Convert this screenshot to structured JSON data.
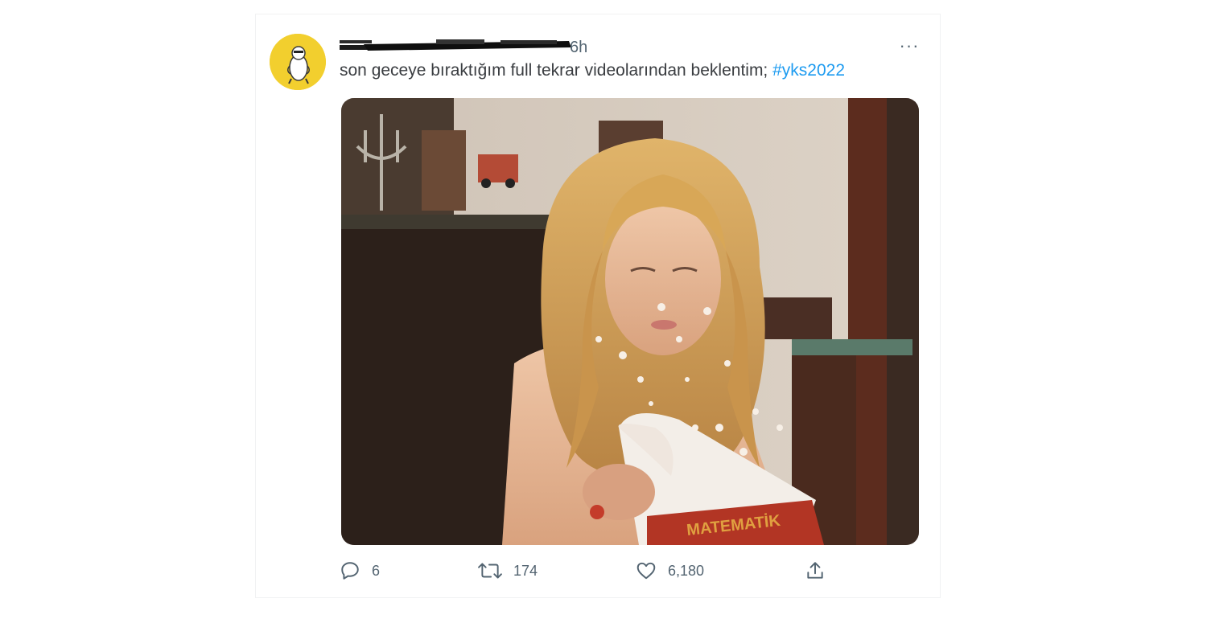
{
  "tweet": {
    "handle_time": "6h",
    "more_label": "···",
    "text_plain": "son geceye bıraktığım full tekrar videolarından beklentim; ",
    "hashtag": "#yks2022",
    "media_caption": "MATEMATİK"
  },
  "actions": {
    "reply_count": "6",
    "retweet_count": "174",
    "like_count": "6,180"
  },
  "icons": {
    "reply": "reply-icon",
    "retweet": "retweet-icon",
    "like": "heart-icon",
    "share": "share-icon",
    "more": "more-icon"
  },
  "colors": {
    "hashtag": "#1d9bf0",
    "secondary_text": "#536471",
    "avatar_bg": "#f2cf2e"
  }
}
